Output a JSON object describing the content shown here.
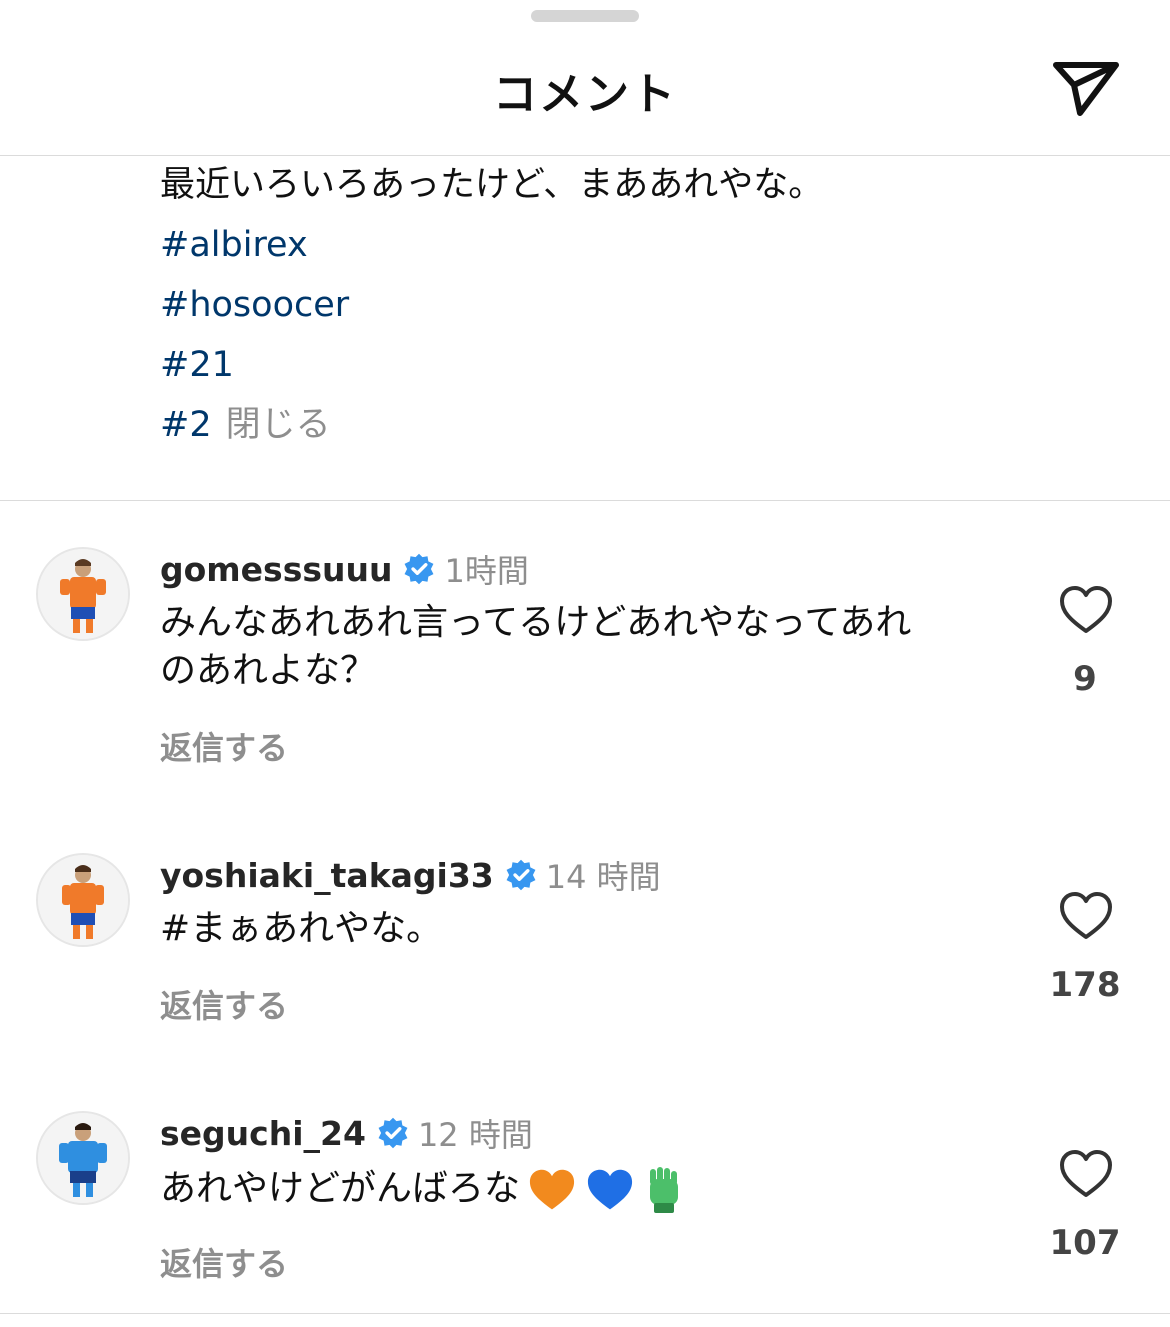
{
  "header": {
    "title": "コメント",
    "share_icon": "paper-plane-icon"
  },
  "caption": {
    "text": "最近いろいろあったけど、まああれやな。",
    "hashtags": [
      "#albirex",
      "#hosoocer",
      "#21",
      "#2"
    ],
    "close_label": "閉じる"
  },
  "comments": [
    {
      "username": "gomesssuuu",
      "verified": true,
      "time": "1時間",
      "text_line1": "みんなあれあれ言ってるけどあれやなってあれ",
      "text_line2": "のあれよな？",
      "reply_label": "返信する",
      "likes": "9",
      "avatar_kit_color": "#f07a2a"
    },
    {
      "username": "yoshiaki_takagi33",
      "verified": true,
      "time": "14 時間",
      "text": "#まぁあれやな。",
      "reply_label": "返信する",
      "likes": "178",
      "avatar_kit_color": "#f07a2a"
    },
    {
      "username": "seguchi_24",
      "verified": true,
      "time": "12 時間",
      "text": "あれやけどがんばろな",
      "emojis": [
        "orange-heart",
        "blue-heart",
        "gloves"
      ],
      "reply_label": "返信する",
      "likes": "107",
      "avatar_kit_color": "#2f8fe0"
    }
  ],
  "colors": {
    "hashtag": "#00376b",
    "muted": "#8e8e8e",
    "verified": "#3897f0"
  }
}
